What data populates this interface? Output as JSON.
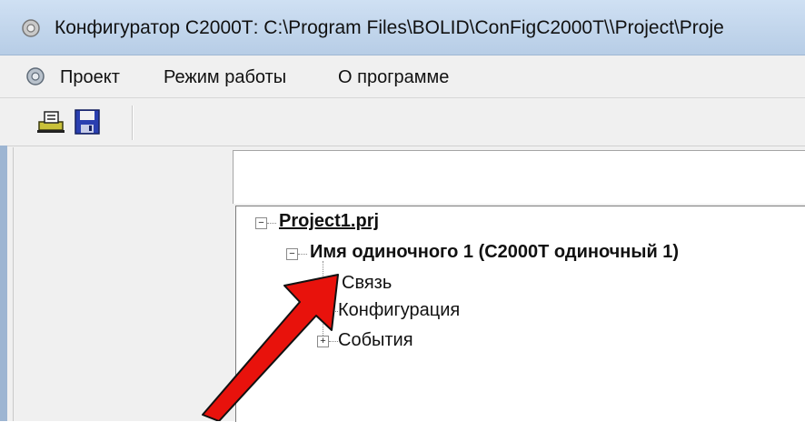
{
  "window": {
    "title": "Конфигуратор С2000Т: C:\\Program Files\\BOLID\\ConFigC2000T\\\\Project\\Proje"
  },
  "menu": {
    "items": [
      "Проект",
      "Режим работы",
      "О программе"
    ]
  },
  "toolbar": {
    "buttons": [
      {
        "icon": "open-project-icon"
      },
      {
        "icon": "save-disk-icon"
      }
    ]
  },
  "tree": {
    "root": {
      "label": "Project1.prj",
      "expander": "−"
    },
    "device": {
      "label": "Имя одиночного 1 (С2000Т одиночный 1)",
      "expander": "−"
    },
    "children": [
      {
        "label": "Связь",
        "expander": ""
      },
      {
        "label": "Конфигурация",
        "expander": "+"
      },
      {
        "label": "События",
        "expander": "+"
      }
    ]
  },
  "annotation": {
    "color": "#e8120c",
    "icon": "red-arrow-pointer"
  }
}
